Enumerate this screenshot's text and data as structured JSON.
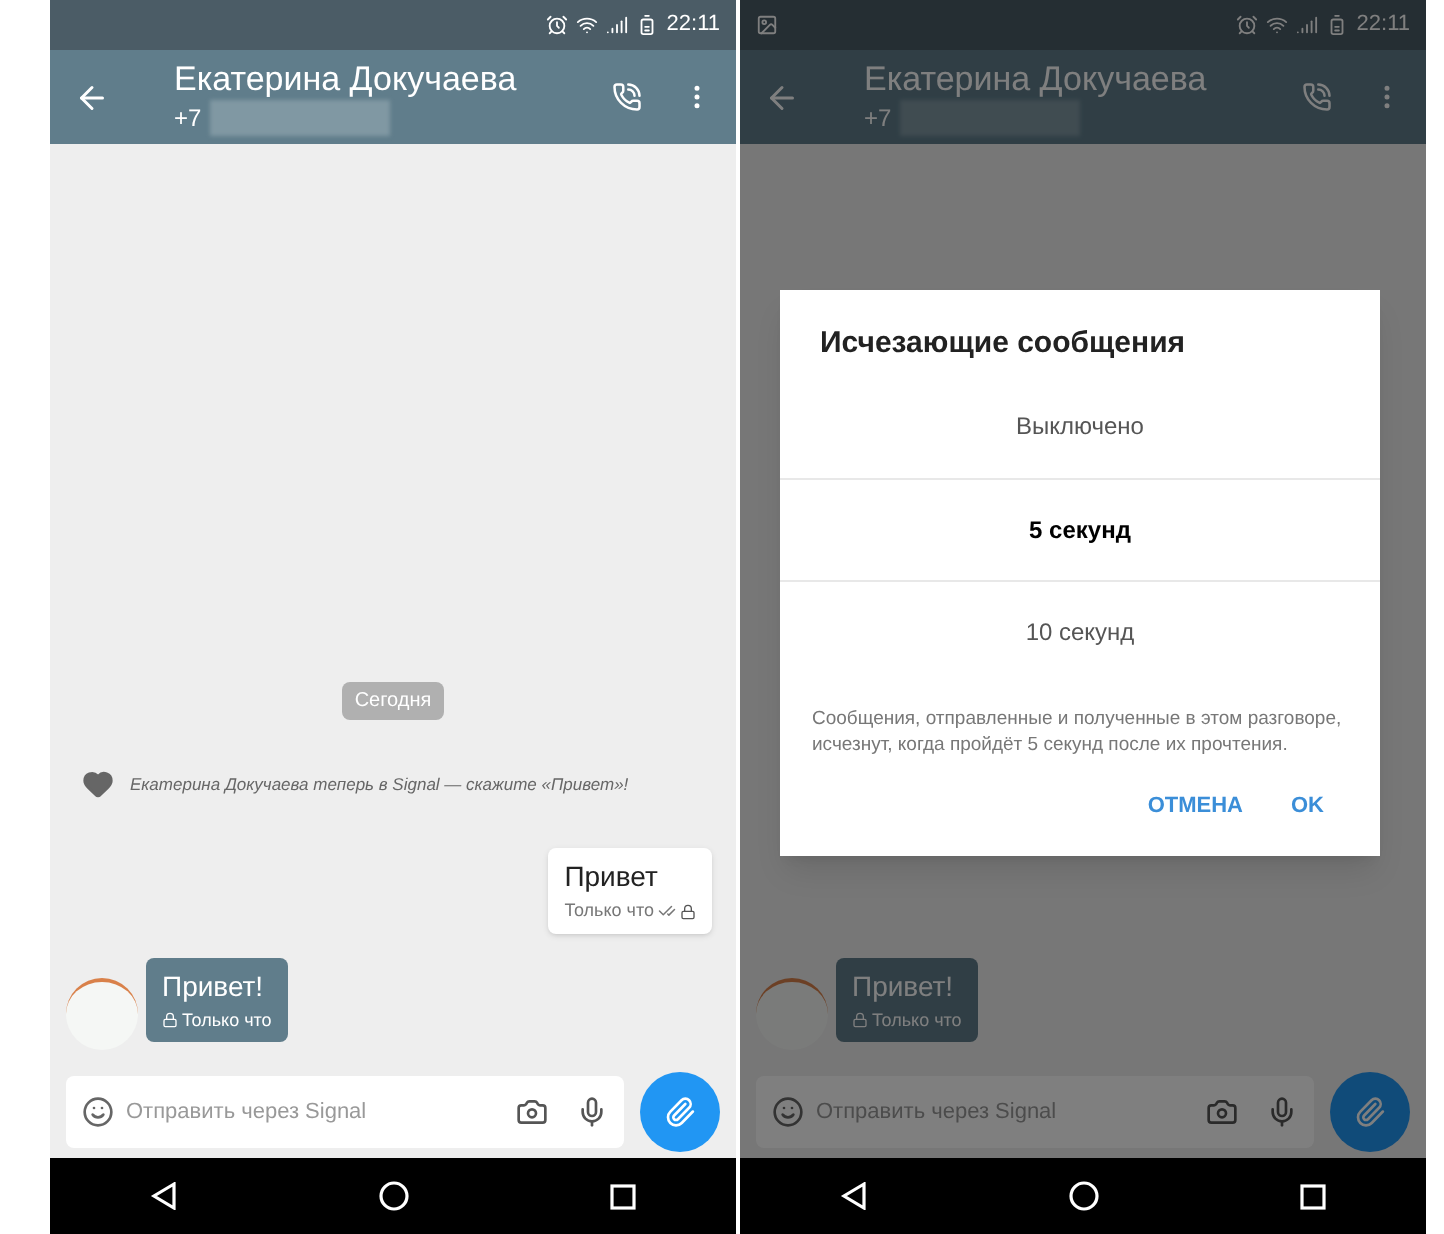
{
  "screens": [
    {
      "dimmed": false,
      "status_bar": {
        "time": "22:11",
        "notification": false
      },
      "header": {
        "name": "Екатерина Докучаева",
        "phone": "+7"
      },
      "day_label": "Сегодня",
      "system_message": "Екатерина Докучаева теперь в Signal — скажите «Привет»!",
      "messages": [
        {
          "kind": "outgoing",
          "text": "Привет",
          "time": "Только что"
        },
        {
          "kind": "incoming",
          "text": "Привет!",
          "time": "Только что"
        }
      ],
      "composer": {
        "placeholder": "Отправить через Signal"
      }
    },
    {
      "dimmed": true,
      "status_bar": {
        "time": "22:11",
        "notification": true
      },
      "header": {
        "name": "Екатерина Докучаева",
        "phone": "+7"
      },
      "messages": [
        {
          "kind": "incoming",
          "text": "Привет!",
          "time": "Только что"
        }
      ],
      "composer": {
        "placeholder": "Отправить через Signal"
      },
      "dialog": {
        "title": "Исчезающие сообщения",
        "options": [
          {
            "label": "Выключено",
            "selected": false
          },
          {
            "label": "5 секунд",
            "selected": true
          },
          {
            "label": "10 секунд",
            "selected": false
          }
        ],
        "description": "Сообщения, отправленные и полученные в этом разговоре, исчезнут, когда пройдёт 5 секунд после их прочтения.",
        "buttons": [
          "ОТМЕНА",
          "OK"
        ]
      }
    }
  ]
}
